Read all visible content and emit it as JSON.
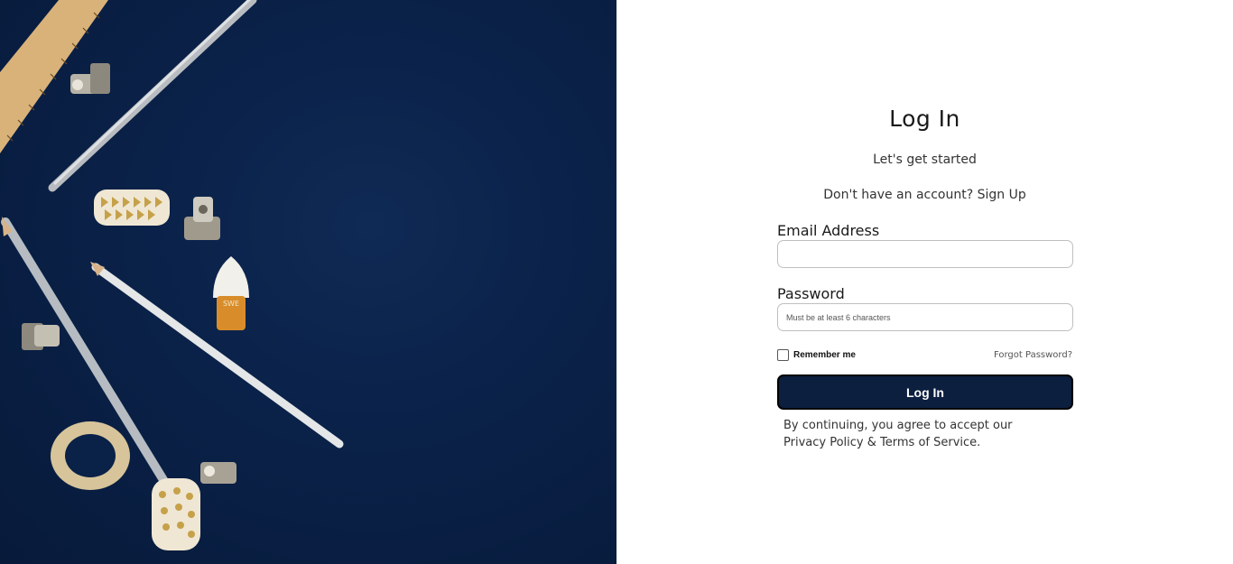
{
  "login": {
    "title": "Log In",
    "subtitle": "Let's get started",
    "no_account_text": "Don't have an account?",
    "signup_link": "Sign Up",
    "email_label": "Email Address",
    "email_value": "",
    "email_placeholder": "",
    "password_label": "Password",
    "password_value": "",
    "password_placeholder": "Must be at least 6 characters",
    "remember_label": "Remember me",
    "remember_checked": false,
    "forgot_link": "Forgot Password?",
    "submit_label": "Log In",
    "legal_prefix": "By continuing, you agree to accept our",
    "privacy_link": "Privacy Policy",
    "legal_amp": "&",
    "terms_link": "Terms of Service",
    "legal_period": "."
  },
  "hero": {
    "image_description_icon": "stationery-flatlay-image"
  },
  "colors": {
    "hero_background": "#0a2148",
    "button_background": "#0c1f3f",
    "text": "#1a1a1a"
  }
}
